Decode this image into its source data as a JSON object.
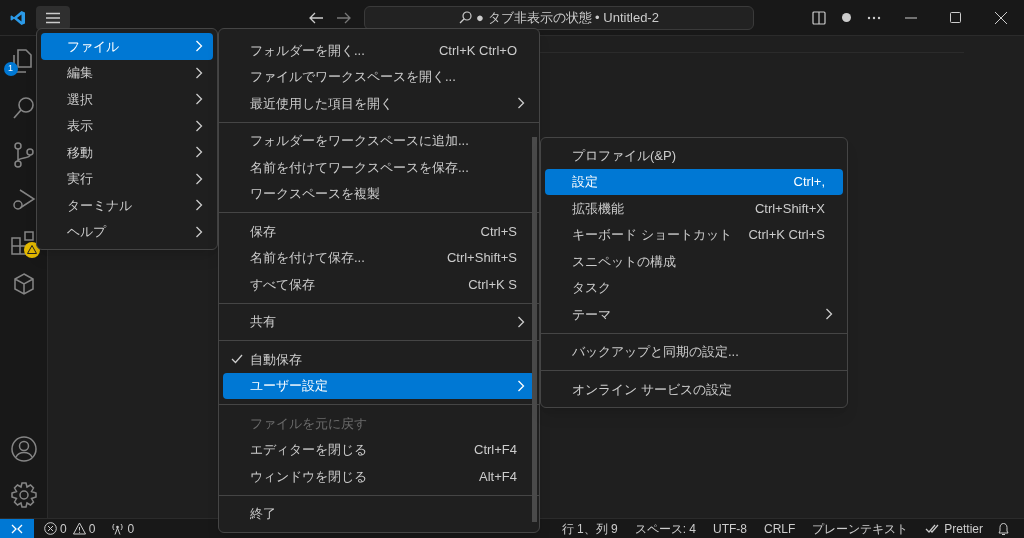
{
  "title_bar": {
    "command_center": "● タブ非表示の状態 • Untitled-2"
  },
  "activity_bar": {
    "explorer_badge": "1"
  },
  "main_menu": [
    {
      "label": "ファイル",
      "selected": true
    },
    {
      "label": "編集",
      "selected": false
    },
    {
      "label": "選択",
      "selected": false
    },
    {
      "label": "表示",
      "selected": false
    },
    {
      "label": "移動",
      "selected": false
    },
    {
      "label": "実行",
      "selected": false
    },
    {
      "label": "ターミナル",
      "selected": false
    },
    {
      "label": "ヘルプ",
      "selected": false
    }
  ],
  "file_menu": [
    [
      {
        "label": "フォルダーを開く...",
        "shortcut": "Ctrl+K Ctrl+O",
        "submenu": false,
        "checked": false,
        "disabled": false,
        "selected": false
      },
      {
        "label": "ファイルでワークスペースを開く...",
        "submenu": false,
        "checked": false,
        "disabled": false,
        "selected": false
      },
      {
        "label": "最近使用した項目を開く",
        "submenu": true,
        "checked": false,
        "disabled": false,
        "selected": false
      }
    ],
    [
      {
        "label": "フォルダーをワークスペースに追加...",
        "submenu": false,
        "checked": false,
        "disabled": false,
        "selected": false
      },
      {
        "label": "名前を付けてワークスペースを保存...",
        "submenu": false,
        "checked": false,
        "disabled": false,
        "selected": false
      },
      {
        "label": "ワークスペースを複製",
        "submenu": false,
        "checked": false,
        "disabled": false,
        "selected": false
      }
    ],
    [
      {
        "label": "保存",
        "shortcut": "Ctrl+S",
        "submenu": false,
        "checked": false,
        "disabled": false,
        "selected": false
      },
      {
        "label": "名前を付けて保存...",
        "shortcut": "Ctrl+Shift+S",
        "submenu": false,
        "checked": false,
        "disabled": false,
        "selected": false
      },
      {
        "label": "すべて保存",
        "shortcut": "Ctrl+K S",
        "submenu": false,
        "checked": false,
        "disabled": false,
        "selected": false
      }
    ],
    [
      {
        "label": "共有",
        "submenu": true,
        "checked": false,
        "disabled": false,
        "selected": false
      }
    ],
    [
      {
        "label": "自動保存",
        "submenu": false,
        "checked": true,
        "disabled": false,
        "selected": false
      },
      {
        "label": "ユーザー設定",
        "submenu": true,
        "checked": false,
        "disabled": false,
        "selected": true
      }
    ],
    [
      {
        "label": "ファイルを元に戻す",
        "submenu": false,
        "checked": false,
        "disabled": true,
        "selected": false
      },
      {
        "label": "エディターを閉じる",
        "shortcut": "Ctrl+F4",
        "submenu": false,
        "checked": false,
        "disabled": false,
        "selected": false
      },
      {
        "label": "ウィンドウを閉じる",
        "shortcut": "Alt+F4",
        "submenu": false,
        "checked": false,
        "disabled": false,
        "selected": false
      }
    ],
    [
      {
        "label": "終了",
        "submenu": false,
        "checked": false,
        "disabled": false,
        "selected": false
      }
    ]
  ],
  "settings_menu": [
    [
      {
        "label": "プロファイル(&P)",
        "submenu": false,
        "selected": false
      },
      {
        "label": "設定",
        "shortcut": "Ctrl+,",
        "submenu": false,
        "selected": true
      },
      {
        "label": "拡張機能",
        "shortcut": "Ctrl+Shift+X",
        "submenu": false,
        "selected": false
      },
      {
        "label": "キーボード ショートカット",
        "shortcut": "Ctrl+K Ctrl+S",
        "submenu": false,
        "selected": false
      },
      {
        "label": "スニペットの構成",
        "submenu": false,
        "selected": false
      },
      {
        "label": "タスク",
        "submenu": false,
        "selected": false
      },
      {
        "label": "テーマ",
        "submenu": true,
        "selected": false
      }
    ],
    [
      {
        "label": "バックアップと同期の設定...",
        "submenu": false,
        "selected": false
      }
    ],
    [
      {
        "label": "オンライン サービスの設定",
        "submenu": false,
        "selected": false
      }
    ]
  ],
  "status_bar": {
    "errors": "0",
    "warnings": "0",
    "ports": "0",
    "right": [
      {
        "kind": "text",
        "label": "行 1、列 9"
      },
      {
        "kind": "text",
        "label": "スペース: 4"
      },
      {
        "kind": "text",
        "label": "UTF-8"
      },
      {
        "kind": "text",
        "label": "CRLF"
      },
      {
        "kind": "text",
        "label": "プレーンテキスト"
      },
      {
        "kind": "prettier",
        "label": "Prettier"
      }
    ]
  }
}
